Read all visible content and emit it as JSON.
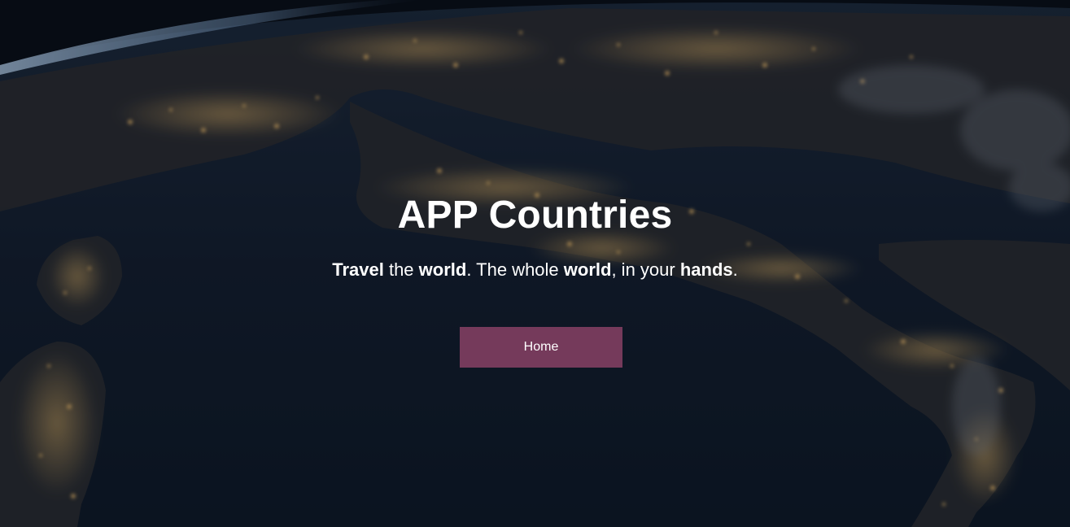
{
  "hero": {
    "background": "night-earth-satellite-image",
    "title": "APP Countries",
    "tagline": {
      "w1": "Travel",
      "t1": " the ",
      "w2": "world",
      "t2": ". The whole ",
      "w3": "world",
      "t3": ", in your ",
      "w4": "hands",
      "t4": "."
    },
    "home_button": {
      "label": "Home",
      "color": "#753a5b"
    }
  },
  "colors": {
    "text": "#ffffff",
    "overlay": "#0b1320",
    "accent": "#753a5b",
    "city_lights": "#f2b25a"
  }
}
